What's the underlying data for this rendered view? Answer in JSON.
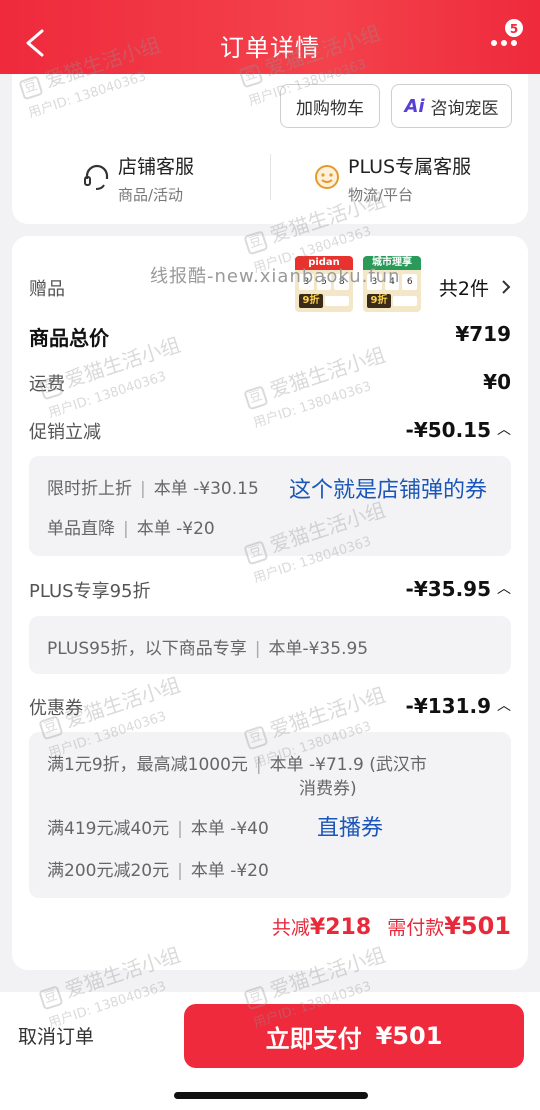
{
  "header": {
    "title": "订单详情",
    "badge_count": "5",
    "accent": "#ee2a3c"
  },
  "actions": {
    "add_cart": "加购物车",
    "consult_vet": "咨询宠医",
    "ai_mark": "Ai"
  },
  "services": {
    "shop": {
      "title": "店铺客服",
      "sub": "商品/活动",
      "icon": "headset-icon"
    },
    "plus": {
      "title": "PLUS专属客服",
      "sub": "物流/平台",
      "icon": "smile-icon"
    }
  },
  "watermark_text": "线报酷-new.xianbaoku.fun",
  "gifts": {
    "label": "赠品",
    "count_text": "共2件",
    "thumb1": {
      "brand": "pidan",
      "cells": [
        "3",
        "5",
        "8"
      ],
      "discount": "9折"
    },
    "thumb2": {
      "brand": "城市理享",
      "cells": [
        "3",
        "4",
        "6"
      ],
      "discount": "9折"
    }
  },
  "summary": {
    "total_label": "商品总价",
    "total_value": "¥719",
    "shipping_label": "运费",
    "shipping_value": "¥0"
  },
  "promo": {
    "label": "促销立减",
    "value": "-¥50.15",
    "lines": [
      {
        "name": "限时折上折",
        "detail": "本单 -¥30.15"
      },
      {
        "name": "单品直降",
        "detail": "本单 -¥20"
      }
    ],
    "annotation": "这个就是店铺弹的券"
  },
  "plus95": {
    "label": "PLUS专享95折",
    "value": "-¥35.95",
    "line": {
      "name": "PLUS95折，以下商品专享",
      "detail": "本单-¥35.95"
    }
  },
  "coupons": {
    "label": "优惠券",
    "value": "-¥131.9",
    "lines": [
      {
        "name": "满1元9折，最高减1000元",
        "detail": "本单 -¥71.9 (武汉市",
        "detail2": "消费券)"
      },
      {
        "name": "满419元减40元",
        "detail": "本单 -¥40"
      },
      {
        "name": "满200元减20元",
        "detail": "本单 -¥20"
      }
    ],
    "annotation": "直播券"
  },
  "totals": {
    "saved_label": "共减",
    "saved_value": "¥218",
    "pay_label": "需付款",
    "pay_value": "¥501"
  },
  "bottom": {
    "cancel": "取消订单",
    "pay_label": "立即支付",
    "pay_value": "¥501"
  },
  "watermark": {
    "main": "爱猫生活小组",
    "sub": "用户ID: 138040363",
    "mark": "豆"
  }
}
